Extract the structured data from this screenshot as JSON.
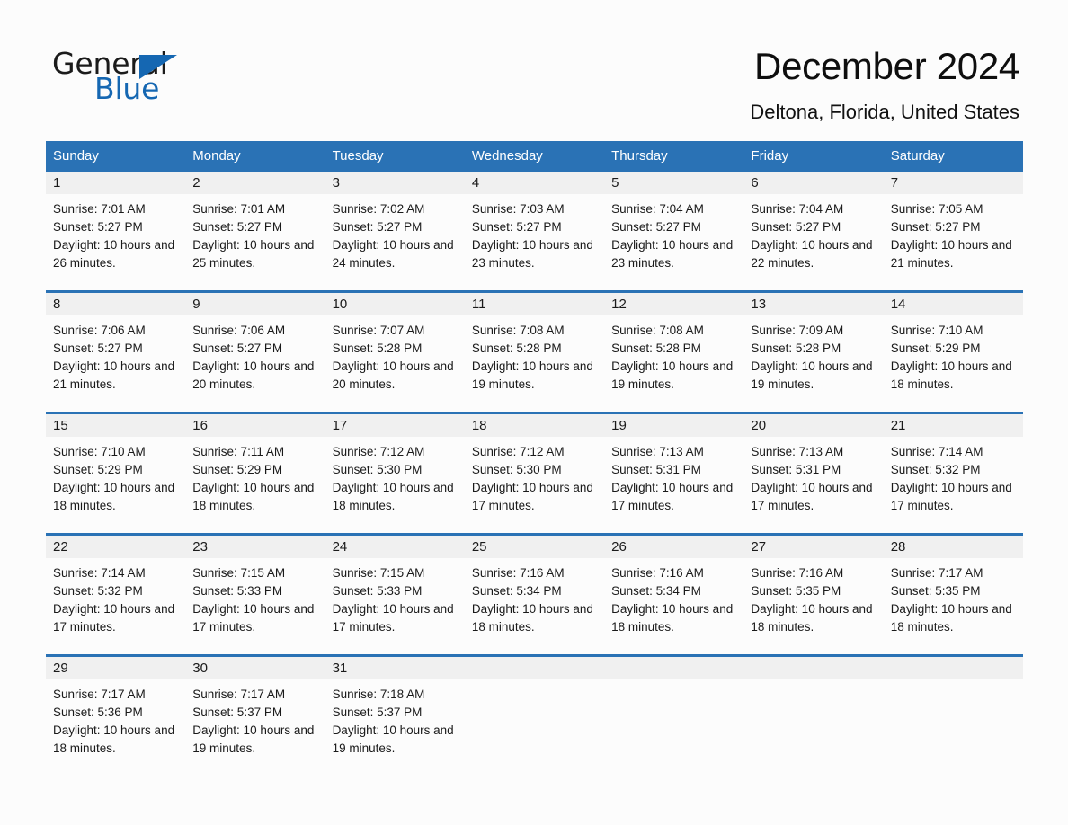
{
  "brand": {
    "name_part1": "General",
    "name_part2": "Blue",
    "accent_color": "#1567b2"
  },
  "header": {
    "title": "December 2024",
    "subtitle": "Deltona, Florida, United States",
    "header_bg": "#2a72b5",
    "date_band_bg": "#f0f0f0"
  },
  "weekday_headers": [
    "Sunday",
    "Monday",
    "Tuesday",
    "Wednesday",
    "Thursday",
    "Friday",
    "Saturday"
  ],
  "weeks": [
    {
      "days": [
        {
          "date": "1",
          "sunrise": "Sunrise: 7:01 AM",
          "sunset": "Sunset: 5:27 PM",
          "daylight": "Daylight: 10 hours and 26 minutes."
        },
        {
          "date": "2",
          "sunrise": "Sunrise: 7:01 AM",
          "sunset": "Sunset: 5:27 PM",
          "daylight": "Daylight: 10 hours and 25 minutes."
        },
        {
          "date": "3",
          "sunrise": "Sunrise: 7:02 AM",
          "sunset": "Sunset: 5:27 PM",
          "daylight": "Daylight: 10 hours and 24 minutes."
        },
        {
          "date": "4",
          "sunrise": "Sunrise: 7:03 AM",
          "sunset": "Sunset: 5:27 PM",
          "daylight": "Daylight: 10 hours and 23 minutes."
        },
        {
          "date": "5",
          "sunrise": "Sunrise: 7:04 AM",
          "sunset": "Sunset: 5:27 PM",
          "daylight": "Daylight: 10 hours and 23 minutes."
        },
        {
          "date": "6",
          "sunrise": "Sunrise: 7:04 AM",
          "sunset": "Sunset: 5:27 PM",
          "daylight": "Daylight: 10 hours and 22 minutes."
        },
        {
          "date": "7",
          "sunrise": "Sunrise: 7:05 AM",
          "sunset": "Sunset: 5:27 PM",
          "daylight": "Daylight: 10 hours and 21 minutes."
        }
      ]
    },
    {
      "days": [
        {
          "date": "8",
          "sunrise": "Sunrise: 7:06 AM",
          "sunset": "Sunset: 5:27 PM",
          "daylight": "Daylight: 10 hours and 21 minutes."
        },
        {
          "date": "9",
          "sunrise": "Sunrise: 7:06 AM",
          "sunset": "Sunset: 5:27 PM",
          "daylight": "Daylight: 10 hours and 20 minutes."
        },
        {
          "date": "10",
          "sunrise": "Sunrise: 7:07 AM",
          "sunset": "Sunset: 5:28 PM",
          "daylight": "Daylight: 10 hours and 20 minutes."
        },
        {
          "date": "11",
          "sunrise": "Sunrise: 7:08 AM",
          "sunset": "Sunset: 5:28 PM",
          "daylight": "Daylight: 10 hours and 19 minutes."
        },
        {
          "date": "12",
          "sunrise": "Sunrise: 7:08 AM",
          "sunset": "Sunset: 5:28 PM",
          "daylight": "Daylight: 10 hours and 19 minutes."
        },
        {
          "date": "13",
          "sunrise": "Sunrise: 7:09 AM",
          "sunset": "Sunset: 5:28 PM",
          "daylight": "Daylight: 10 hours and 19 minutes."
        },
        {
          "date": "14",
          "sunrise": "Sunrise: 7:10 AM",
          "sunset": "Sunset: 5:29 PM",
          "daylight": "Daylight: 10 hours and 18 minutes."
        }
      ]
    },
    {
      "days": [
        {
          "date": "15",
          "sunrise": "Sunrise: 7:10 AM",
          "sunset": "Sunset: 5:29 PM",
          "daylight": "Daylight: 10 hours and 18 minutes."
        },
        {
          "date": "16",
          "sunrise": "Sunrise: 7:11 AM",
          "sunset": "Sunset: 5:29 PM",
          "daylight": "Daylight: 10 hours and 18 minutes."
        },
        {
          "date": "17",
          "sunrise": "Sunrise: 7:12 AM",
          "sunset": "Sunset: 5:30 PM",
          "daylight": "Daylight: 10 hours and 18 minutes."
        },
        {
          "date": "18",
          "sunrise": "Sunrise: 7:12 AM",
          "sunset": "Sunset: 5:30 PM",
          "daylight": "Daylight: 10 hours and 17 minutes."
        },
        {
          "date": "19",
          "sunrise": "Sunrise: 7:13 AM",
          "sunset": "Sunset: 5:31 PM",
          "daylight": "Daylight: 10 hours and 17 minutes."
        },
        {
          "date": "20",
          "sunrise": "Sunrise: 7:13 AM",
          "sunset": "Sunset: 5:31 PM",
          "daylight": "Daylight: 10 hours and 17 minutes."
        },
        {
          "date": "21",
          "sunrise": "Sunrise: 7:14 AM",
          "sunset": "Sunset: 5:32 PM",
          "daylight": "Daylight: 10 hours and 17 minutes."
        }
      ]
    },
    {
      "days": [
        {
          "date": "22",
          "sunrise": "Sunrise: 7:14 AM",
          "sunset": "Sunset: 5:32 PM",
          "daylight": "Daylight: 10 hours and 17 minutes."
        },
        {
          "date": "23",
          "sunrise": "Sunrise: 7:15 AM",
          "sunset": "Sunset: 5:33 PM",
          "daylight": "Daylight: 10 hours and 17 minutes."
        },
        {
          "date": "24",
          "sunrise": "Sunrise: 7:15 AM",
          "sunset": "Sunset: 5:33 PM",
          "daylight": "Daylight: 10 hours and 17 minutes."
        },
        {
          "date": "25",
          "sunrise": "Sunrise: 7:16 AM",
          "sunset": "Sunset: 5:34 PM",
          "daylight": "Daylight: 10 hours and 18 minutes."
        },
        {
          "date": "26",
          "sunrise": "Sunrise: 7:16 AM",
          "sunset": "Sunset: 5:34 PM",
          "daylight": "Daylight: 10 hours and 18 minutes."
        },
        {
          "date": "27",
          "sunrise": "Sunrise: 7:16 AM",
          "sunset": "Sunset: 5:35 PM",
          "daylight": "Daylight: 10 hours and 18 minutes."
        },
        {
          "date": "28",
          "sunrise": "Sunrise: 7:17 AM",
          "sunset": "Sunset: 5:35 PM",
          "daylight": "Daylight: 10 hours and 18 minutes."
        }
      ]
    },
    {
      "days": [
        {
          "date": "29",
          "sunrise": "Sunrise: 7:17 AM",
          "sunset": "Sunset: 5:36 PM",
          "daylight": "Daylight: 10 hours and 18 minutes."
        },
        {
          "date": "30",
          "sunrise": "Sunrise: 7:17 AM",
          "sunset": "Sunset: 5:37 PM",
          "daylight": "Daylight: 10 hours and 19 minutes."
        },
        {
          "date": "31",
          "sunrise": "Sunrise: 7:18 AM",
          "sunset": "Sunset: 5:37 PM",
          "daylight": "Daylight: 10 hours and 19 minutes."
        },
        {
          "date": "",
          "sunrise": "",
          "sunset": "",
          "daylight": ""
        },
        {
          "date": "",
          "sunrise": "",
          "sunset": "",
          "daylight": ""
        },
        {
          "date": "",
          "sunrise": "",
          "sunset": "",
          "daylight": ""
        },
        {
          "date": "",
          "sunrise": "",
          "sunset": "",
          "daylight": ""
        }
      ]
    }
  ]
}
